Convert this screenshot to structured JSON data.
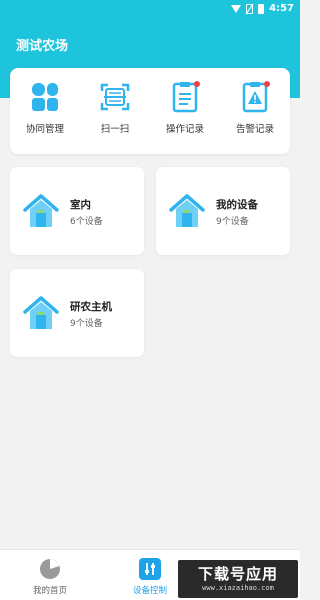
{
  "status_bar": {
    "time": "4:57"
  },
  "header": {
    "title": "测试农场"
  },
  "quick_actions": [
    {
      "label": "协同管理",
      "icon": "collaboration-icon"
    },
    {
      "label": "扫一扫",
      "icon": "scan-icon"
    },
    {
      "label": "操作记录",
      "icon": "operation-log-icon"
    },
    {
      "label": "告警记录",
      "icon": "alarm-log-icon"
    }
  ],
  "devices": [
    {
      "name": "室内",
      "count": "6个设备",
      "icon": "house-icon"
    },
    {
      "name": "我的设备",
      "count": "9个设备",
      "icon": "house-icon"
    },
    {
      "name": "研农主机",
      "count": "9个设备",
      "icon": "house-icon"
    }
  ],
  "bottom_nav": [
    {
      "label": "我的首页",
      "icon": "home-pie-icon",
      "active": false
    },
    {
      "label": "设备控制",
      "icon": "device-control-icon",
      "active": true
    }
  ],
  "watermark": {
    "main": "下载号应用",
    "sub": "www.xiazaihao.com"
  },
  "colors": {
    "primary": "#1ec4dc",
    "icon_blue": "#2fb4ee",
    "nav_active": "#1ea2e8",
    "badge_red": "#f04040"
  }
}
